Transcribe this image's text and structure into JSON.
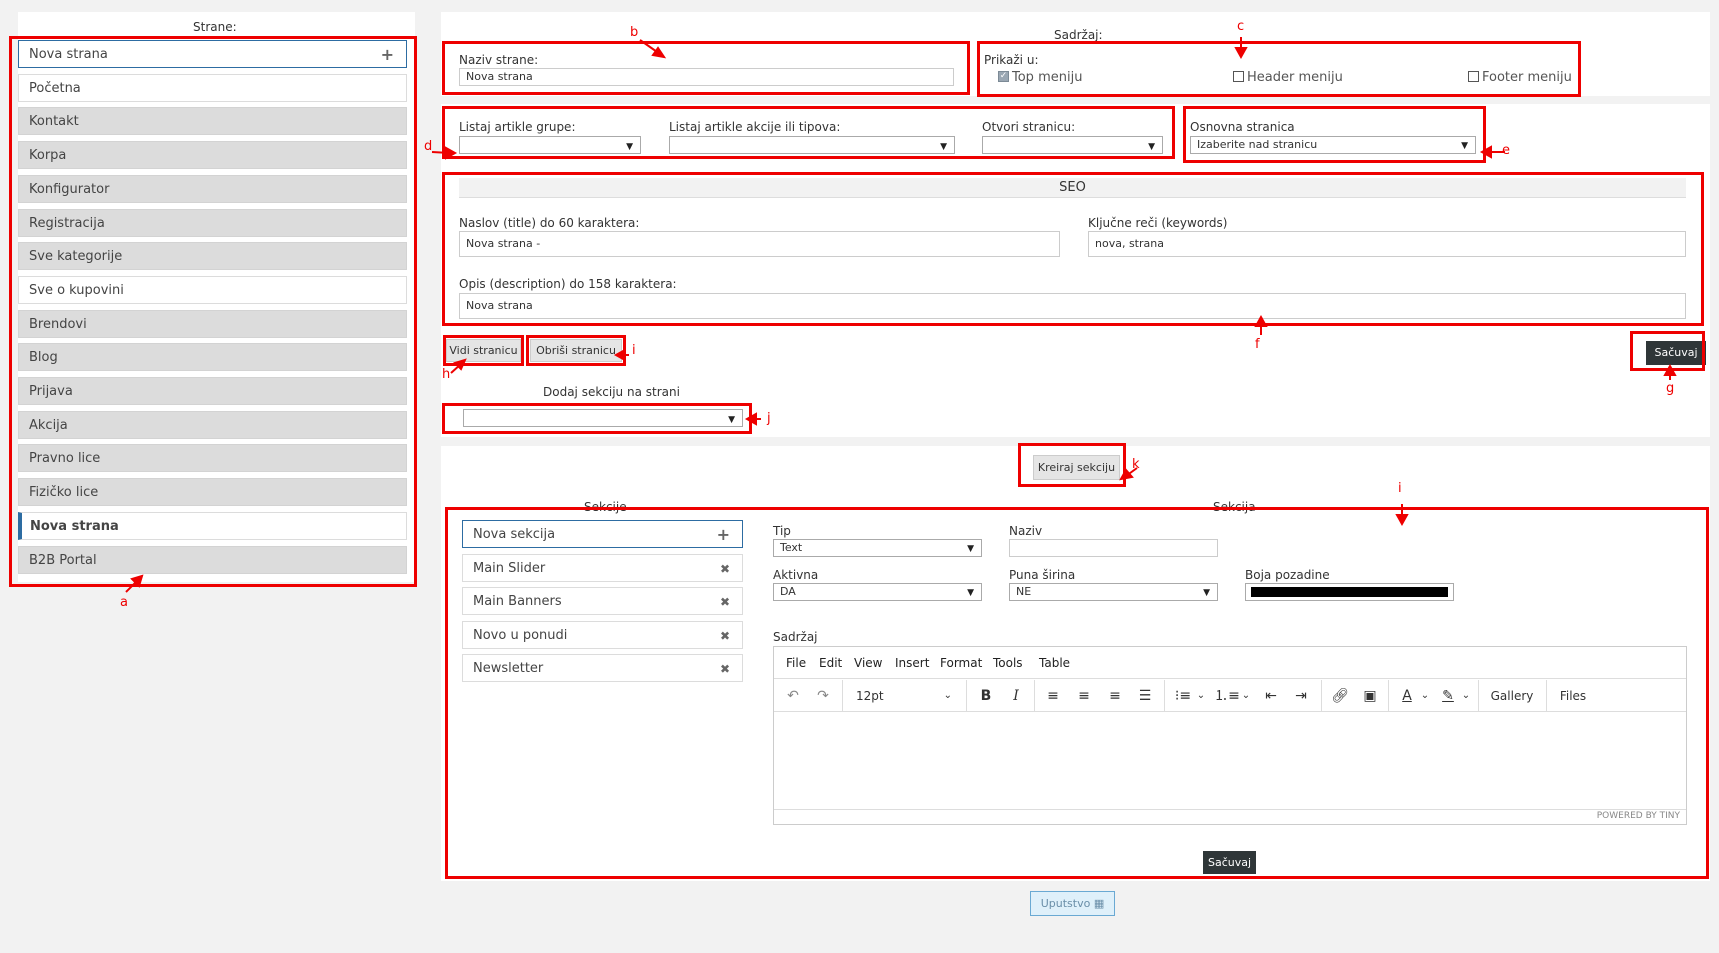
{
  "pages_panel": {
    "title": "Strane:",
    "items": [
      "Nova strana",
      "Početna",
      "Kontakt",
      "Korpa",
      "Konfigurator",
      "Registracija",
      "Sve kategorije",
      "Sve o kupovini",
      "Brendovi",
      "Blog",
      "Prijava",
      "Akcija",
      "Pravno lice",
      "Fizičko lice",
      "Nova strana",
      "B2B Portal"
    ]
  },
  "content": {
    "title": "Sadržaj:",
    "page_name_label": "Naziv strane:",
    "page_name_value": "Nova strana",
    "show_in_label": "Prikaži u:",
    "top_menu": "Top meniju",
    "header_menu": "Header meniju",
    "footer_menu": "Footer meniju",
    "list_groups_label": "Listaj artikle grupe:",
    "list_actions_label": "Listaj artikle akcije ili tipova:",
    "open_page_label": "Otvori stranicu:",
    "base_page_label": "Osnovna stranica",
    "base_page_value": "Izaberite nad stranicu"
  },
  "seo": {
    "title": "SEO",
    "title_label": "Naslov (title) do 60 karaktera:",
    "title_value": "Nova strana -",
    "keywords_label": "Ključne reči (keywords)",
    "keywords_value": "nova, strana",
    "desc_label": "Opis (description) do 158 karaktera:",
    "desc_value": "Nova strana"
  },
  "actions": {
    "view_page": "Vidi stranicu",
    "delete_page": "Obriši stranicu",
    "save": "Sačuvaj",
    "add_section_label": "Dodaj sekciju na strani",
    "create_section": "Kreiraj sekciju"
  },
  "sections": {
    "list_title": "Sekcije",
    "items": [
      "Nova sekcija",
      "Main Slider",
      "Main Banners",
      "Novo u ponudi",
      "Newsletter"
    ],
    "form_title": "Sekcija",
    "type_label": "Tip",
    "type_value": "Text",
    "name_label": "Naziv",
    "active_label": "Aktivna",
    "active_value": "DA",
    "full_width_label": "Puna širina",
    "full_width_value": "NE",
    "bg_color_label": "Boja pozadine",
    "bg_color": "#000000",
    "content_label": "Sadržaj",
    "save": "Sačuvaj"
  },
  "editor": {
    "menu": [
      "File",
      "Edit",
      "View",
      "Insert",
      "Format",
      "Tools",
      "Table"
    ],
    "font_size": "12pt",
    "gallery": "Gallery",
    "files": "Files",
    "powered": "POWERED BY TINY"
  },
  "help_button": "Uputstvo",
  "annotations": [
    "a",
    "b",
    "c",
    "d",
    "e",
    "f",
    "g",
    "h",
    "i",
    "j",
    "k",
    "i"
  ],
  "colors": {
    "annotation": "#e00000",
    "accent": "#2d6ca2",
    "dark_button": "#2f3638"
  }
}
